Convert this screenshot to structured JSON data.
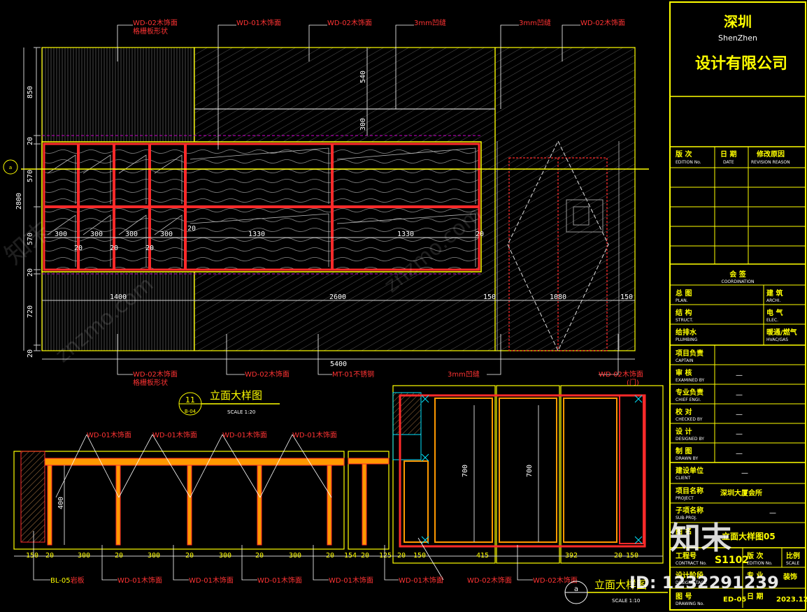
{
  "title_block": {
    "company_city_cn": "深圳",
    "company_city_en": "ShenZhen",
    "company_name": "设计有限公司",
    "revision_headers": [
      {
        "cn": "版 次",
        "en": "EDITION No."
      },
      {
        "cn": "日 期",
        "en": "DATE"
      },
      {
        "cn": "修改原因",
        "en": "REVISION REASON"
      }
    ],
    "coordination_cn": "会 签",
    "coordination_en": "COORDINATION",
    "coordination_rows": [
      {
        "left_cn": "总 图",
        "left_en": "PLAN.",
        "right_cn": "建 筑",
        "right_en": "ARCHI."
      },
      {
        "left_cn": "结 构",
        "left_en": "STRUCT.",
        "right_cn": "电 气",
        "right_en": "ELEC."
      },
      {
        "left_cn": "给排水",
        "left_en": "PLUMBING",
        "right_cn": "暖通/燃气",
        "right_en": "HVAC/GAS"
      }
    ],
    "sign_rows": [
      {
        "cn": "项目负责",
        "en": "CAPTAIN",
        "value": ""
      },
      {
        "cn": "审 核",
        "en": "EXAMINED BY",
        "value": "—"
      },
      {
        "cn": "专业负责",
        "en": "CHIEF ENGI.",
        "value": "—"
      },
      {
        "cn": "校 对",
        "en": "CHECKED BY",
        "value": "—"
      },
      {
        "cn": "设 计",
        "en": "DESIGNED BY",
        "value": "—"
      },
      {
        "cn": "制 图",
        "en": "DRAWN BY",
        "value": "—"
      }
    ],
    "client_cn": "建设单位",
    "client_en": "CLIENT",
    "client_value": "—",
    "project_cn": "项目名称",
    "project_en": "PROJECT",
    "project_value": "深圳大厦会所",
    "subproject_cn": "子项名称",
    "subproject_en": "SUB-PROJ.",
    "subproject_value": "—",
    "drawing_name_cn": "图 名",
    "drawing_name_value": "立面大样图05",
    "contract_cn": "工程号",
    "contract_en": "CONTRACT No.",
    "contract_value": "S1102",
    "edition_cn": "版 次",
    "edition_en": "EDITION No.",
    "scale_cn": "比例",
    "scale_en": "SCALE",
    "design_stage_cn": "设计阶段",
    "design_stage_en": "DESIGN STAGE",
    "discipline_cn": "专 业",
    "discipline_value": "装饰",
    "drawing_no_cn": "图 号",
    "drawing_no_en": "DRAWING No.",
    "drawing_no_value": "ED-05",
    "date_cn": "日 期",
    "date_value": "2023.12"
  },
  "elevation": {
    "title": "立面大样图",
    "scale": "SCALE 1:20",
    "bubble_num": "11",
    "bubble_ref": "B-04",
    "marker_a": "a",
    "top_callouts": [
      {
        "code": "WD-02",
        "name": "木饰面",
        "sub": "格栅板形状"
      },
      {
        "code": "WD-01",
        "name": "木饰面",
        "sub": ""
      },
      {
        "code": "WD-02",
        "name": "木饰面",
        "sub": ""
      },
      {
        "code": "",
        "name": "3mm凹缝",
        "sub": ""
      },
      {
        "code": "",
        "name": "3mm凹缝",
        "sub": ""
      },
      {
        "code": "WD-02",
        "name": "木饰面",
        "sub": ""
      }
    ],
    "bottom_callouts": [
      {
        "code": "WD-02",
        "name": "木饰面",
        "sub": "格栅板形状"
      },
      {
        "code": "WD-02",
        "name": "木饰面",
        "sub": ""
      },
      {
        "code": "MT-01",
        "name": "不锈钢",
        "sub": ""
      },
      {
        "code": "",
        "name": "3mm凹缝",
        "sub": ""
      },
      {
        "code": "WD-02",
        "name": "木饰面",
        "sub": "(门)"
      }
    ],
    "left_dims": [
      "850",
      "20",
      "570",
      "2800",
      "570",
      "20",
      "720",
      "20"
    ],
    "inner_dims": [
      "540",
      "300"
    ],
    "shelf_widths": [
      "300",
      "300",
      "300",
      "300",
      "1330",
      "1330"
    ],
    "shelf_gaps": [
      "20",
      "20",
      "20",
      "20",
      "20",
      "20"
    ],
    "bottom_dims": [
      "1400",
      "2600",
      "150",
      "1080",
      "150"
    ],
    "total_width": "5400"
  },
  "detail": {
    "title": "立面大样图",
    "scale": "SCALE 1:10",
    "marker": "a",
    "top_callouts": [
      {
        "code": "WD-01",
        "name": "木饰面"
      },
      {
        "code": "WD-01",
        "name": "木饰面"
      },
      {
        "code": "WD-01",
        "name": "木饰面"
      },
      {
        "code": "WD-01",
        "name": "木饰面"
      }
    ],
    "bottom_callouts": [
      {
        "code": "BL-05",
        "name": "岩板"
      },
      {
        "code": "WD-01",
        "name": "木饰面"
      },
      {
        "code": "WD-01",
        "name": "木饰面"
      },
      {
        "code": "WD-01",
        "name": "木饰面"
      },
      {
        "code": "WD-01",
        "name": "木饰面"
      },
      {
        "code": "WD-01",
        "name": "木饰面"
      },
      {
        "code": "WD-02",
        "name": "木饰面"
      },
      {
        "code": "WD-02",
        "name": "木饰面"
      }
    ],
    "height_dims": [
      "400",
      "700",
      "700"
    ],
    "bottom_dims": [
      "150",
      "20",
      "300",
      "20",
      "300",
      "20",
      "300",
      "20",
      "300",
      "20",
      "154",
      "20",
      "125",
      "20",
      "150",
      "415",
      "392",
      "20",
      "150"
    ]
  },
  "watermark": {
    "brand": "知末",
    "id_label": "ID: 1232291239",
    "site": "znzmo.com"
  },
  "colors": {
    "background": "#000000",
    "frame": "#ffff00",
    "wood": "#ff2a2a",
    "line": "#ffffff",
    "accent": "#cc00cc",
    "cyan": "#00e5ff"
  }
}
